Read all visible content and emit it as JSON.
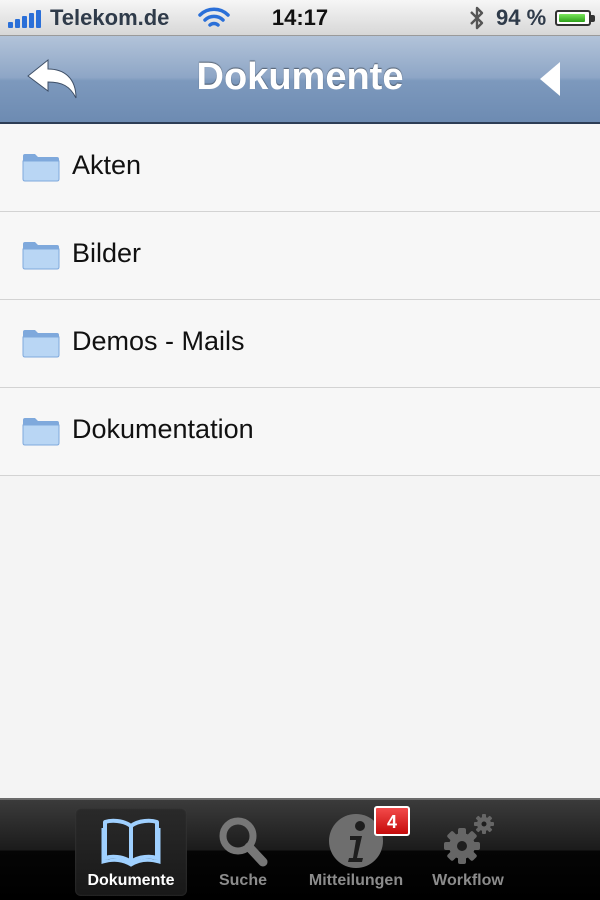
{
  "status_bar": {
    "carrier": "Telekom.de",
    "time": "14:17",
    "battery_percent": "94 %",
    "battery_level": 0.94,
    "signal_bars": 5
  },
  "nav": {
    "title": "Dokumente",
    "back_icon": "reply-arrow-icon",
    "right_icon": "play-left-icon"
  },
  "folders": [
    {
      "label": "Akten"
    },
    {
      "label": "Bilder"
    },
    {
      "label": "Demos - Mails"
    },
    {
      "label": "Dokumentation"
    }
  ],
  "tabs": [
    {
      "label": "Dokumente",
      "icon": "book-icon",
      "active": true
    },
    {
      "label": "Suche",
      "icon": "magnifier-icon",
      "active": false
    },
    {
      "label": "Mitteilungen",
      "icon": "info-icon",
      "active": false,
      "badge": "4"
    },
    {
      "label": "Workflow",
      "icon": "gears-icon",
      "active": false
    }
  ],
  "colors": {
    "nav_top": "#b2c3d9",
    "nav_bottom": "#6d8bb2",
    "badge": "#d91a1a",
    "folder": "#9cc3ee"
  }
}
